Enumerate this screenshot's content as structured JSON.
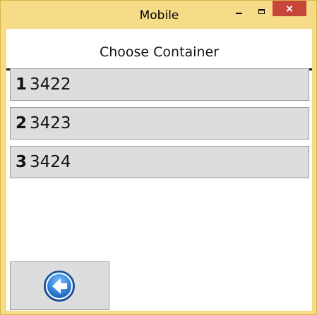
{
  "window": {
    "title": "Mobile",
    "close_glyph": "×"
  },
  "header": {
    "title": "Choose Container"
  },
  "containers": [
    {
      "index": "1",
      "number": "3422"
    },
    {
      "index": "2",
      "number": "3423"
    },
    {
      "index": "3",
      "number": "3424"
    }
  ],
  "back_button": {
    "icon": "back-arrow-icon"
  },
  "colors": {
    "frame": "#f6dc86",
    "close_button": "#c7463a",
    "list_item_bg": "#dddddd",
    "back_icon_blue": "#2f7fd8"
  }
}
